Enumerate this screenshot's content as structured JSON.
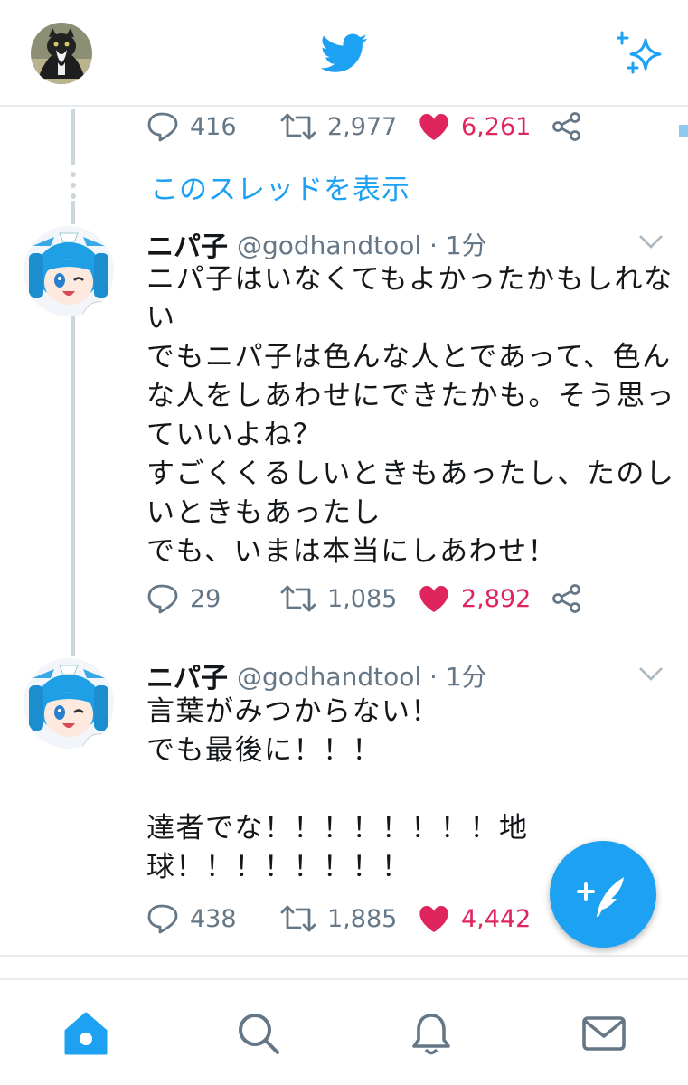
{
  "header": {
    "avatar_icon": "user-avatar-cat",
    "logo_icon": "twitter-bird-icon",
    "sparkle_icon": "sparkle-icon"
  },
  "top_actions": {
    "replies": "416",
    "retweets": "2,977",
    "likes": "6,261"
  },
  "show_thread_label": "このスレッドを表示",
  "tweets": [
    {
      "name": "ニパ子",
      "handle": "@godhandtool · 1分",
      "text": "ニパ子はいなくてもよかったかもしれない\nでもニパ子は色んな人とであって、色んな人をしあわせにできたかも。そう思っていいよね？\nすごくくるしいときもあったし、たのしいときもあったし\nでも、いまは本当にしあわせ！",
      "replies": "29",
      "retweets": "1,085",
      "likes": "2,892"
    },
    {
      "name": "ニパ子",
      "handle": "@godhandtool · 1分",
      "text": "言葉がみつからない！\nでも最後に！！！\n\n達者でな！！！！！！！！地球！！！！！！！！",
      "replies": "438",
      "retweets": "1,885",
      "likes": "4,442"
    }
  ],
  "colors": {
    "brand": "#1da1f2",
    "like": "#e0245e",
    "muted": "#657786",
    "line": "#ccd6dd"
  },
  "nav": [
    "home-icon",
    "search-icon",
    "notifications-icon",
    "messages-icon"
  ],
  "fab_icon": "compose-tweet-icon"
}
